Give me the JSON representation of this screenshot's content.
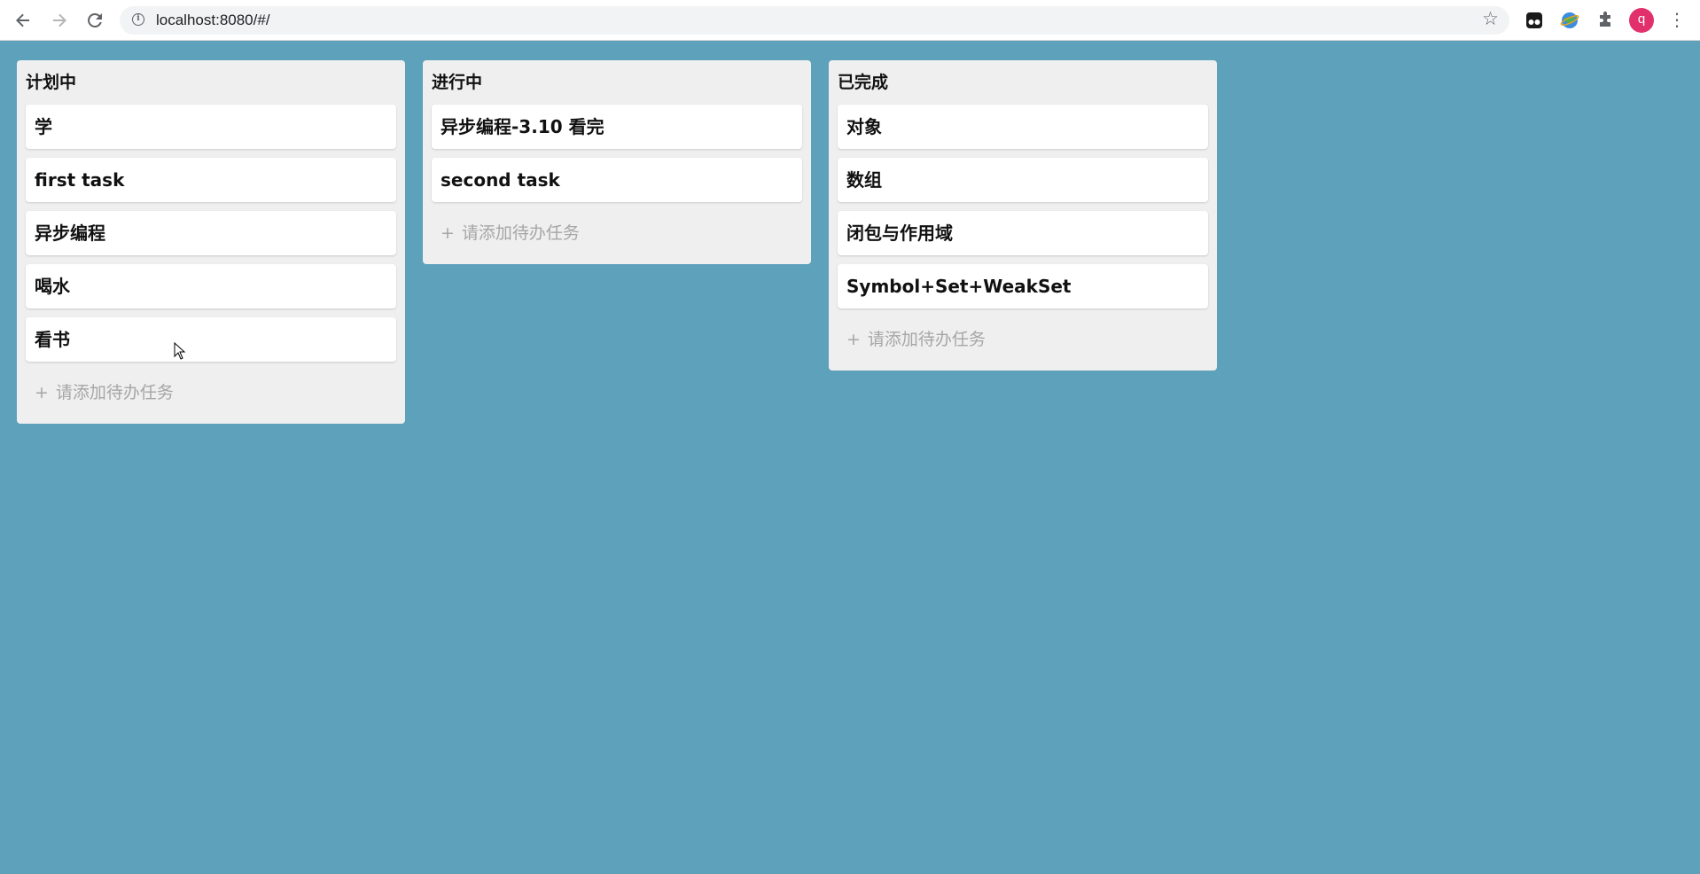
{
  "browser": {
    "url": "localhost:8080/#/",
    "avatar_letter": "q"
  },
  "icons": {
    "back": "back-arrow-icon",
    "forward": "forward-arrow-icon",
    "reload": "reload-icon",
    "info": "info-icon",
    "star": "star-icon",
    "extensions": [
      "tampermonkey-icon",
      "globe-extension-icon",
      "puzzle-icon"
    ],
    "menu": "kebab-menu-icon"
  },
  "colors": {
    "background": "#5da1bb",
    "column": "#efefef",
    "card": "#ffffff",
    "placeholder": "#a6a6a6",
    "avatar": "#e2306c"
  },
  "board": {
    "add_label": "请添加待办任务",
    "columns": [
      {
        "title": "计划中",
        "cards": [
          "学",
          "first task",
          "异步编程",
          "喝水",
          "看书"
        ]
      },
      {
        "title": "进行中",
        "cards": [
          "异步编程-3.10 看完",
          "second task"
        ]
      },
      {
        "title": "已完成",
        "cards": [
          "对象",
          "数组",
          "闭包与作用域",
          "Symbol+Set+WeakSet"
        ]
      }
    ]
  }
}
